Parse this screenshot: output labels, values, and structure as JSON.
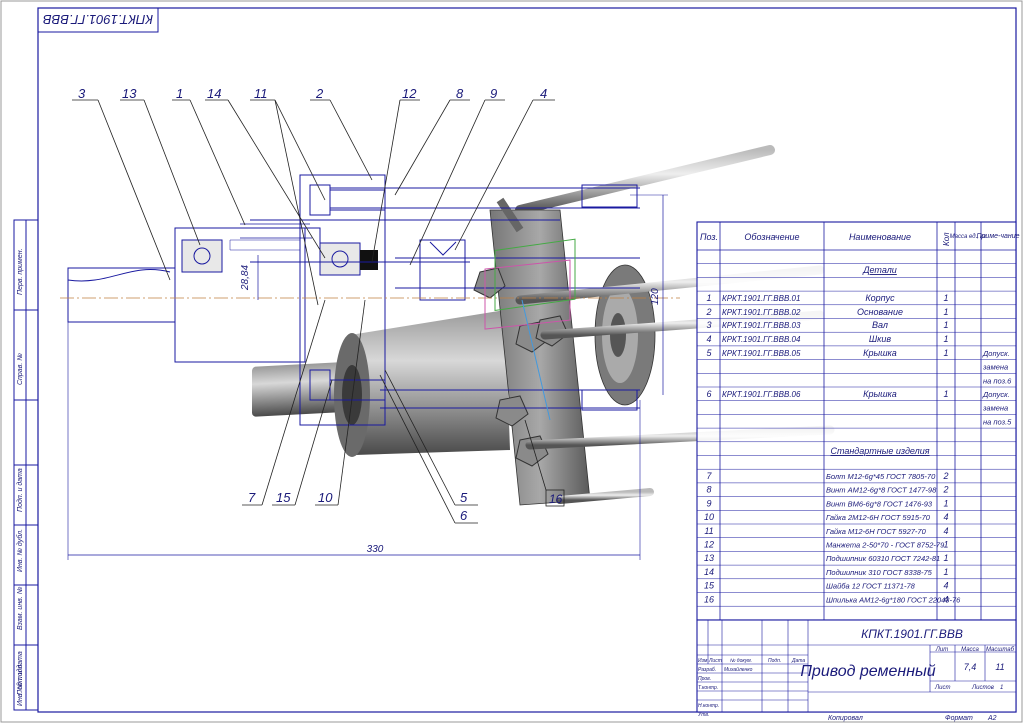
{
  "stamp_code": "КПКТ.1901.ГГ.ВВВ",
  "side_labels": [
    "Перв. примен.",
    "Справ. №",
    "Подп. и дата",
    "Инв. № дубл.",
    "Взам. инв. №",
    "Подп. и дата",
    "Инв. № подл."
  ],
  "callouts_top": [
    "3",
    "13",
    "1",
    "14",
    "11",
    "2",
    "12",
    "8",
    "9",
    "4"
  ],
  "callouts_bottom": [
    "7",
    "15",
    "10",
    "5",
    "6",
    "16"
  ],
  "dimensions": {
    "diameter": "28,84",
    "height": "120",
    "length": "330"
  },
  "spec": {
    "headers": {
      "pos": "Поз.",
      "designation": "Обозначение",
      "name": "Наименование",
      "qty": "Кол",
      "mass": "Масса ед., кг",
      "note": "Приме-чание"
    },
    "section_details": "Детали",
    "section_standard": "Стандартные изделия",
    "rows": [
      {
        "pos": "1",
        "designation": "КРКТ.1901.ГГ.ВВВ.01",
        "name": "Корпус",
        "qty": "1",
        "note": ""
      },
      {
        "pos": "2",
        "designation": "КРКТ.1901.ГГ.ВВВ.02",
        "name": "Основание",
        "qty": "1",
        "note": ""
      },
      {
        "pos": "3",
        "designation": "КРКТ.1901.ГГ.ВВВ.03",
        "name": "Вал",
        "qty": "1",
        "note": ""
      },
      {
        "pos": "4",
        "designation": "КРКТ.1901.ГГ.ВВВ.04",
        "name": "Шкив",
        "qty": "1",
        "note": ""
      },
      {
        "pos": "5",
        "designation": "КРКТ.1901.ГГ.ВВВ.05",
        "name": "Крышка",
        "qty": "1",
        "note": "Допуск. замена на поз.6"
      },
      {
        "pos": "6",
        "designation": "КРКТ.1901.ГГ.ВВВ.06",
        "name": "Крышка",
        "qty": "1",
        "note": "Допуск. замена на поз.5"
      }
    ],
    "standard_rows": [
      {
        "pos": "7",
        "name": "Болт М12-6g*45 ГОСТ 7805-70",
        "qty": "2"
      },
      {
        "pos": "8",
        "name": "Винт АМ12-6g*8 ГОСТ 1477-98",
        "qty": "2"
      },
      {
        "pos": "9",
        "name": "Винт ВМ6-6g*8 ГОСТ 1476-93",
        "qty": "1"
      },
      {
        "pos": "10",
        "name": "Гайка 2М12-6Н ГОСТ 5915-70",
        "qty": "4"
      },
      {
        "pos": "11",
        "name": "Гайка М12-6Н ГОСТ 5927-70",
        "qty": "4"
      },
      {
        "pos": "12",
        "name": "Манжета 2-50*70 - ГОСТ 8752-79",
        "qty": "1"
      },
      {
        "pos": "13",
        "name": "Подшипник 60310 ГОСТ 7242-81",
        "qty": "1"
      },
      {
        "pos": "14",
        "name": "Подшипник 310 ГОСТ 8338-75",
        "qty": "1"
      },
      {
        "pos": "15",
        "name": "Шайба 12 ГОСТ 11371-78",
        "qty": "4"
      },
      {
        "pos": "16",
        "name": "Шпилька АМ12-6g*180 ГОСТ 22043-76",
        "qty": "4"
      }
    ]
  },
  "title_block": {
    "doc_code": "КПКТ.1901.ГГ.ВВВ",
    "title": "Привод ременный",
    "hdr_lit": "Лит",
    "hdr_mass": "Масса",
    "hdr_scale": "Масштаб",
    "mass": "7,4",
    "scale": "11",
    "sheet": "Лист",
    "sheets": "Листов",
    "sheets_value": "1",
    "rows": [
      "Изм",
      "Лист",
      "№ докум.",
      "Подп.",
      "Дата"
    ],
    "roles": [
      "Разраб.",
      "Пров.",
      "Т.контр.",
      "Н.контр.",
      "Утв."
    ],
    "developer": "Михайленко",
    "copied": "Копировал",
    "format_label": "Формат",
    "format": "А2"
  }
}
